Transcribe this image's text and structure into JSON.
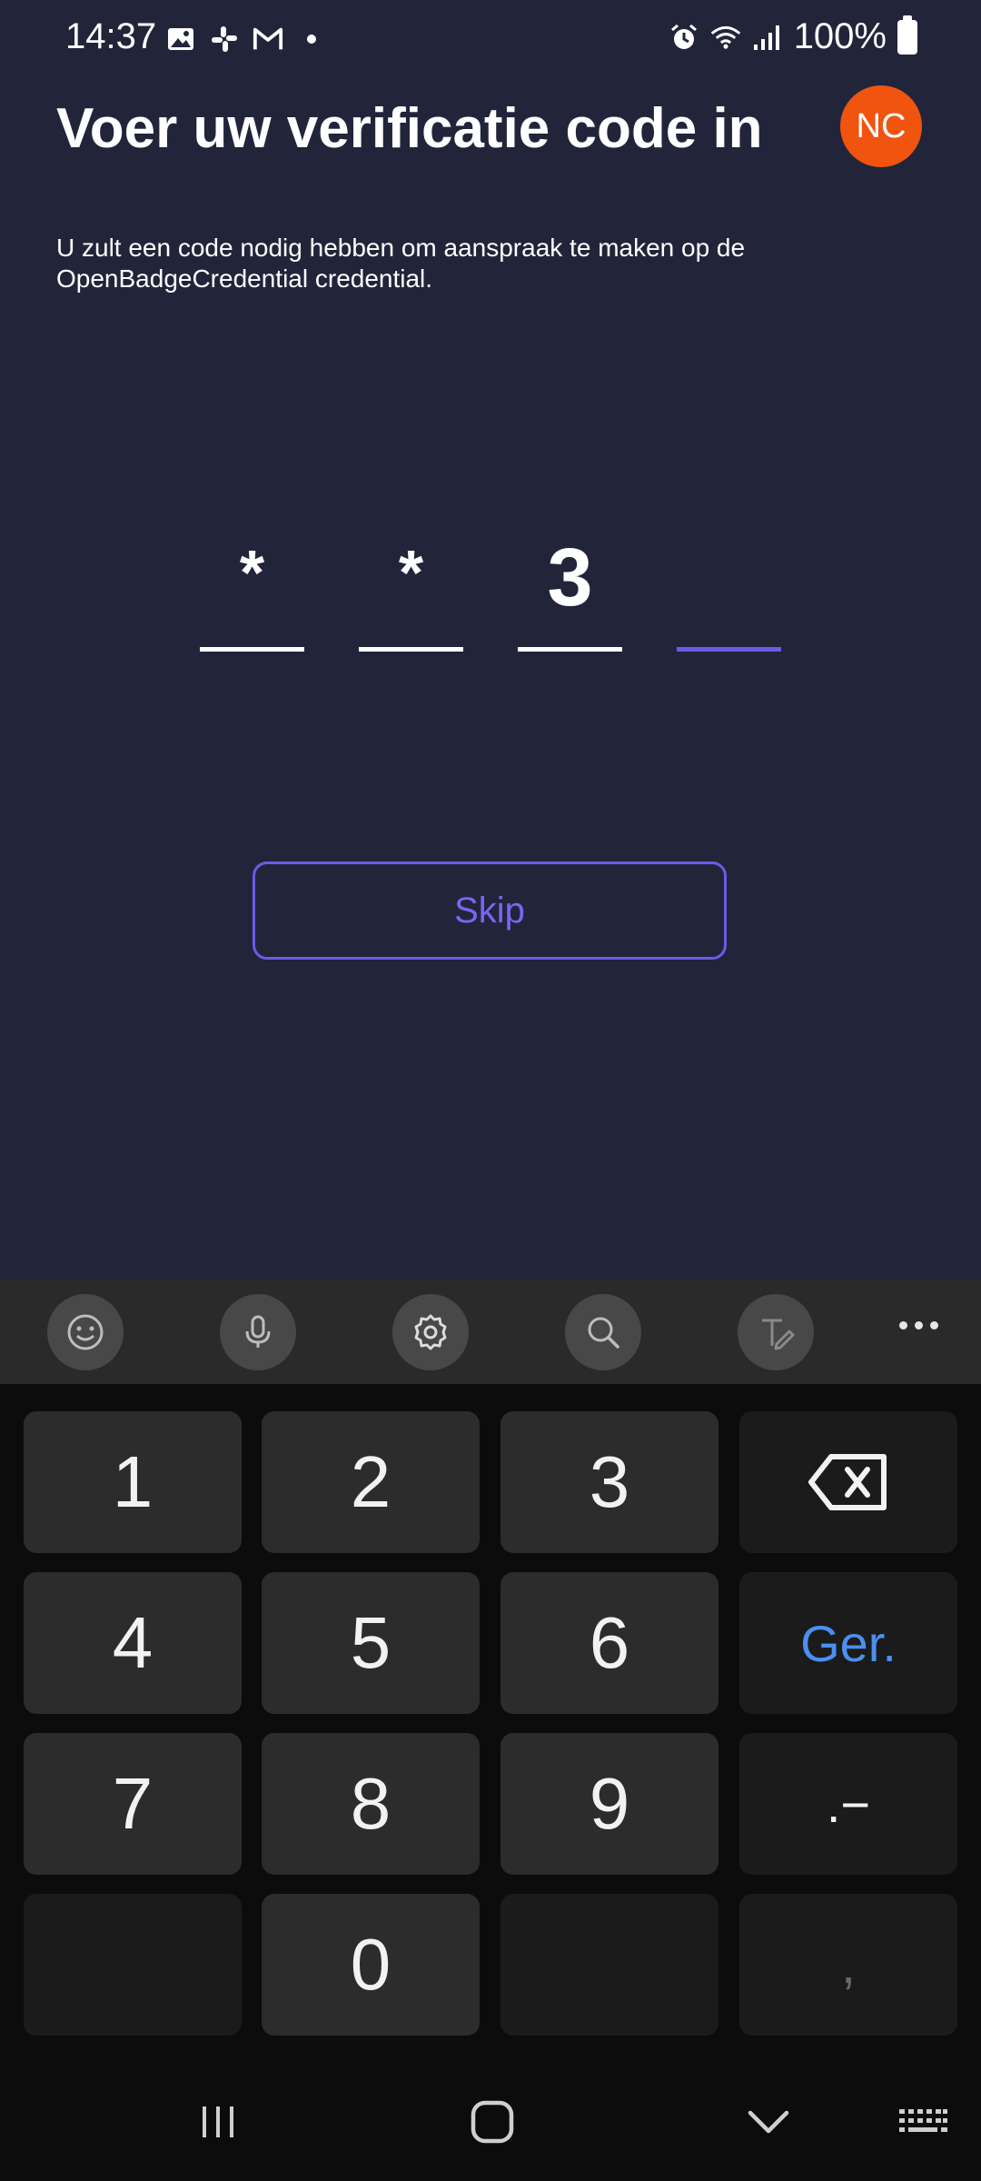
{
  "status_bar": {
    "time": "14:37",
    "battery": "100%",
    "icons_left": [
      "image-icon",
      "slack-icon",
      "gmail-icon",
      "dot-icon"
    ],
    "icons_right": [
      "alarm-icon",
      "wifi-icon",
      "signal-icon",
      "battery-icon"
    ]
  },
  "header": {
    "title": "Voer uw verificatie code in",
    "subtitle": "U zult een code nodig hebben om aanspraak te maken op de OpenBadgeCredential credential.",
    "avatar_initials": "NC",
    "avatar_color": "#f0540f"
  },
  "code": {
    "cells": [
      "*",
      "*",
      "3",
      ""
    ],
    "active_index": 3,
    "accent_color": "#6d5ae8"
  },
  "skip_button": {
    "label": "Skip"
  },
  "keyboard": {
    "toolbar": [
      "emoji-icon",
      "microphone-icon",
      "settings-icon",
      "search-icon",
      "handwriting-icon",
      "more-icon"
    ],
    "keys": {
      "k1": "1",
      "k2": "2",
      "k3": "3",
      "k4": "4",
      "k5": "5",
      "k6": "6",
      "done": "Ger.",
      "k7": "7",
      "k8": "8",
      "k9": "9",
      "symbols": ".−",
      "k0": "0",
      "comma": ","
    }
  },
  "nav_bar": [
    "recent-apps-icon",
    "home-icon",
    "back-icon",
    "keyboard-icon"
  ]
}
